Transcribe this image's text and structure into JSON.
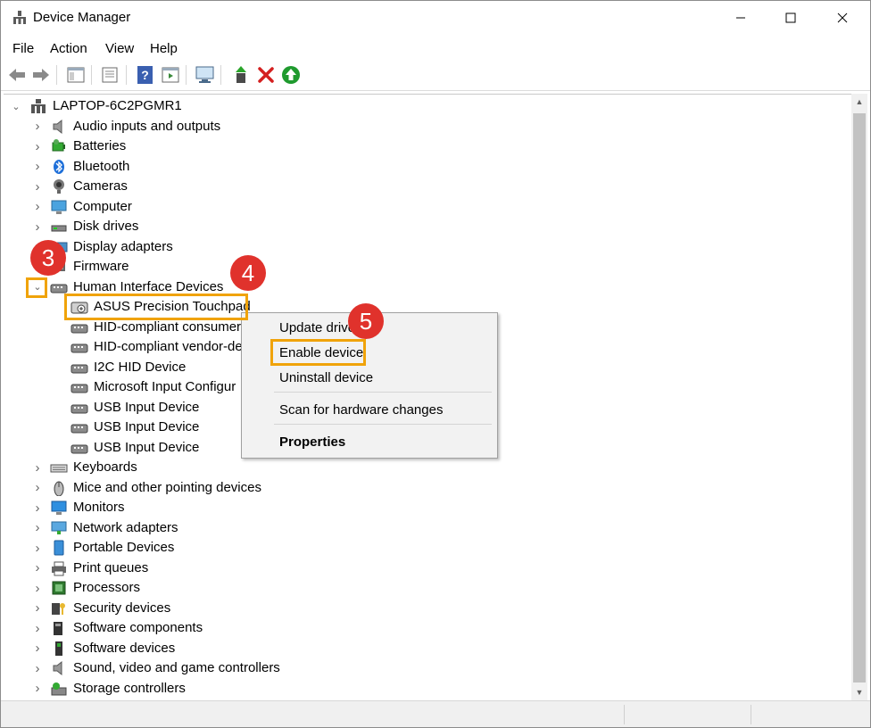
{
  "window": {
    "title": "Device Manager",
    "icon": "device-manager-icon"
  },
  "menu": [
    "File",
    "Action",
    "View",
    "Help"
  ],
  "toolbar": [
    "back-arrow-icon",
    "forward-arrow-icon",
    "properties-icon",
    "update-icon",
    "help-icon",
    "view-icon",
    "scan-monitor-icon",
    "update-driver-icon",
    "uninstall-x-icon",
    "enable-green-icon"
  ],
  "tree": {
    "root": "LAPTOP-6C2PGMR1",
    "categories": [
      {
        "label": "Audio inputs and outputs",
        "icon": "speaker-icon"
      },
      {
        "label": "Batteries",
        "icon": "battery-icon"
      },
      {
        "label": "Bluetooth",
        "icon": "bluetooth-icon"
      },
      {
        "label": "Cameras",
        "icon": "camera-icon"
      },
      {
        "label": "Computer",
        "icon": "computer-icon"
      },
      {
        "label": "Disk drives",
        "icon": "disk-icon"
      },
      {
        "label": "Display adapters",
        "icon": "display-adapter-icon"
      },
      {
        "label": "Firmware",
        "icon": "firmware-icon"
      },
      {
        "label": "Human Interface Devices",
        "icon": "hid-icon"
      }
    ],
    "hid_children": [
      "ASUS Precision Touchpad",
      "HID-compliant consumer",
      "HID-compliant vendor-de",
      "I2C HID Device",
      "Microsoft Input Configur",
      "USB Input Device",
      "USB Input Device",
      "USB Input Device"
    ],
    "more_categories": [
      {
        "label": "Keyboards",
        "icon": "keyboard-icon"
      },
      {
        "label": "Mice and other pointing devices",
        "icon": "mouse-icon"
      },
      {
        "label": "Monitors",
        "icon": "monitor-icon"
      },
      {
        "label": "Network adapters",
        "icon": "network-icon"
      },
      {
        "label": "Portable Devices",
        "icon": "portable-icon"
      },
      {
        "label": "Print queues",
        "icon": "printer-icon"
      },
      {
        "label": "Processors",
        "icon": "processor-icon"
      },
      {
        "label": "Security devices",
        "icon": "security-icon"
      },
      {
        "label": "Software components",
        "icon": "software-component-icon"
      },
      {
        "label": "Software devices",
        "icon": "software-device-icon"
      },
      {
        "label": "Sound, video and game controllers",
        "icon": "sound-icon"
      },
      {
        "label": "Storage controllers",
        "icon": "storage-icon"
      }
    ]
  },
  "context_menu": {
    "items": [
      "Update drive",
      "Enable device",
      "Uninstall device",
      "Scan for hardware changes",
      "Properties"
    ]
  },
  "annotations": {
    "step3": "3",
    "step4": "4",
    "step5": "5",
    "highlight_color": "#f0a30a",
    "badge_color": "#e0322c"
  }
}
